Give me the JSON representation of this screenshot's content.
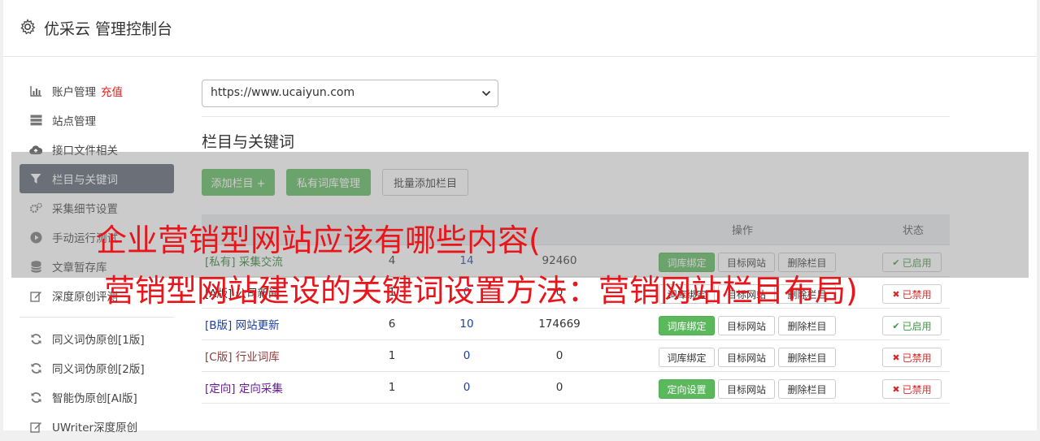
{
  "header": {
    "title": "优采云 管理控制台"
  },
  "sidebar": {
    "items": [
      {
        "label": "账户管理",
        "extra": "充值",
        "icon": "bar-chart-icon"
      },
      {
        "label": "站点管理",
        "icon": "server-icon"
      },
      {
        "label": "接口文件相关",
        "icon": "cloud-upload-icon"
      },
      {
        "label": "栏目与关键词",
        "icon": "filter-icon",
        "active": true
      },
      {
        "label": "采集细节设置",
        "icon": "cogs-icon"
      },
      {
        "label": "手动运行测试",
        "icon": "play-circle-icon"
      },
      {
        "label": "文章暂存库",
        "icon": "database-icon"
      },
      {
        "label": "深度原创评测",
        "icon": "edit-icon"
      }
    ],
    "items2": [
      {
        "label": "同义词伪原创[1版]",
        "icon": "refresh-icon"
      },
      {
        "label": "同义词伪原创[2版]",
        "icon": "refresh-icon"
      },
      {
        "label": "智能伪原创[AI版]",
        "icon": "refresh-icon"
      },
      {
        "label": "UWriter深度原创",
        "icon": "edit-icon"
      }
    ]
  },
  "main": {
    "site_select": "https://www.ucaiyun.com",
    "section_title": "栏目与关键词",
    "buttons": {
      "add": "添加栏目 +",
      "private_lib": "私有词库管理",
      "bulk_add": "批量添加栏目"
    },
    "table": {
      "headers": {
        "ops": "操作",
        "status": "状态"
      },
      "rows": [
        {
          "tag": "[私有]",
          "name": "采集交流",
          "c1": "4",
          "c2": "14",
          "c3": "92460",
          "bind": "词库绑定",
          "target": "目标网站",
          "del": "删除栏目",
          "status": "已启用",
          "on": true,
          "bind_green": true
        },
        {
          "tag": "[A版]",
          "name": "公司新闻",
          "c1": "1",
          "c2": "0",
          "c3": "0",
          "bind": "词库绑定",
          "target": "目标网站",
          "del": "删除栏目",
          "status": "已禁用",
          "on": false,
          "bind_green": false
        },
        {
          "tag": "[B版]",
          "name": "网站更新",
          "c1": "6",
          "c2": "10",
          "c3": "174669",
          "bind": "词库绑定",
          "target": "目标网站",
          "del": "删除栏目",
          "status": "已启用",
          "on": true,
          "bind_green": true
        },
        {
          "tag": "[C版]",
          "name": "行业词库",
          "c1": "1",
          "c2": "0",
          "c3": "0",
          "bind": "词库绑定",
          "target": "目标网站",
          "del": "删除栏目",
          "status": "已禁用",
          "on": false,
          "bind_green": false
        },
        {
          "tag": "[定向]",
          "name": "定向采集",
          "c1": "1",
          "c2": "0",
          "c3": "0",
          "bind": "定向设置",
          "target": "目标网站",
          "del": "删除栏目",
          "status": "已禁用",
          "on": false,
          "bind_green": true
        }
      ]
    }
  },
  "overlay": {
    "line1": "企业营销型网站应该有哪些内容(",
    "line2": "营销型网站建设的关键词设置方法：营销网站栏目布局)"
  },
  "colors": {
    "active_nav": "#5a6270",
    "green": "#5cb85c",
    "red_text": "#e8151b"
  }
}
